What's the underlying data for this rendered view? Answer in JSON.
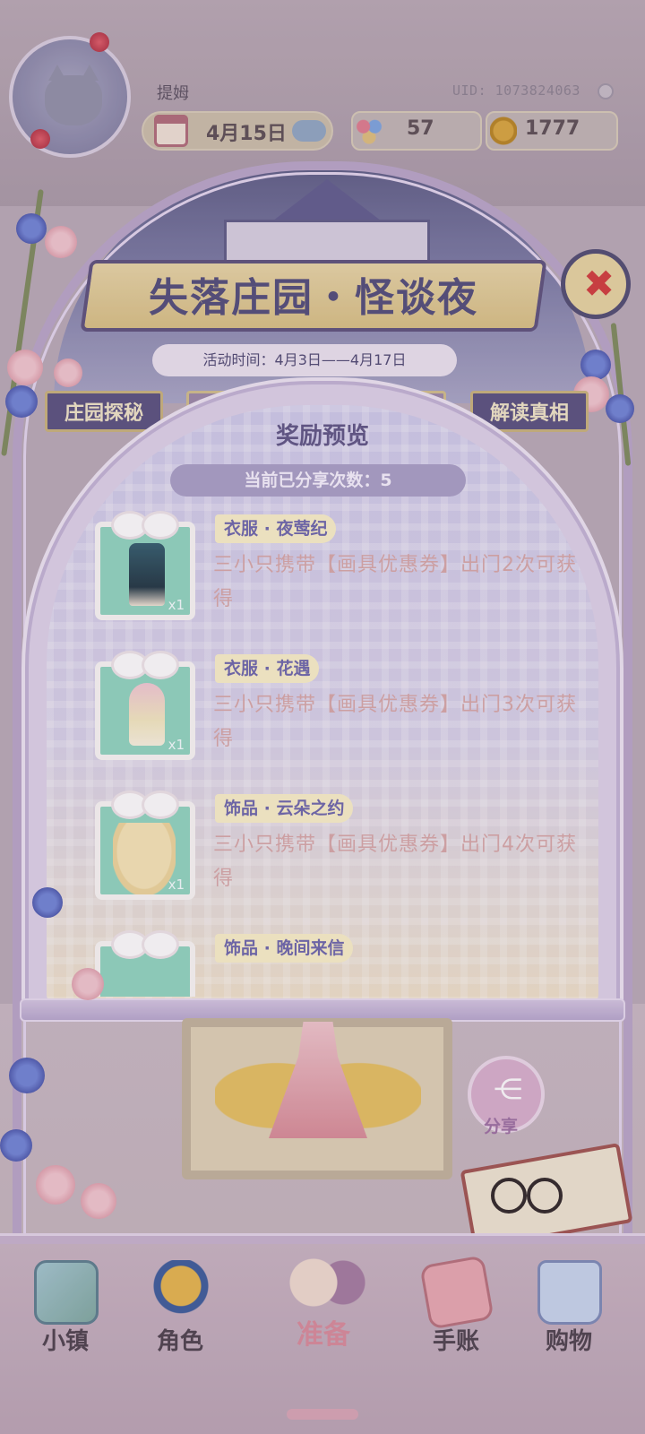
{
  "player": {
    "name": "提姆",
    "uid": "UID: 1073824063"
  },
  "status_bar": {
    "date": "4月15日",
    "gems": "57",
    "coins": "1777"
  },
  "event": {
    "title": "失落庄园・怪谈夜",
    "time": "活动时间：4月3日——4月17日",
    "tabs": [
      "庄园探秘",
      "",
      "解读真相"
    ]
  },
  "reward_panel": {
    "title": "奖励预览",
    "share_count": "当前已分享次数：5",
    "items": [
      {
        "name": "衣服 · 夜莺纪",
        "desc": "三小只携带【画具优惠券】出门2次可获得",
        "qty": "x1"
      },
      {
        "name": "衣服 · 花遇",
        "desc": "三小只携带【画具优惠券】出门3次可获得",
        "qty": "x1"
      },
      {
        "name": "饰品 · 云朵之约",
        "desc": "三小只携带【画具优惠券】出门4次可获得",
        "qty": "x1"
      },
      {
        "name": "饰品 · 晚间来信",
        "desc": "",
        "qty": ""
      }
    ]
  },
  "share": {
    "label": "分享"
  },
  "bottom_nav": [
    {
      "label": "小镇",
      "icon": "map-icon"
    },
    {
      "label": "角色",
      "icon": "character-icon"
    },
    {
      "label": "准备",
      "icon": "wardrobe-icon"
    },
    {
      "label": "手账",
      "icon": "journal-icon"
    },
    {
      "label": "购物",
      "icon": "shopping-bag-icon"
    }
  ],
  "colors": {
    "accent_purple": "#5d5484",
    "reward_name": "#6b66ab",
    "reward_desc": "#d8a8a8",
    "close_red": "#d23a3a"
  }
}
